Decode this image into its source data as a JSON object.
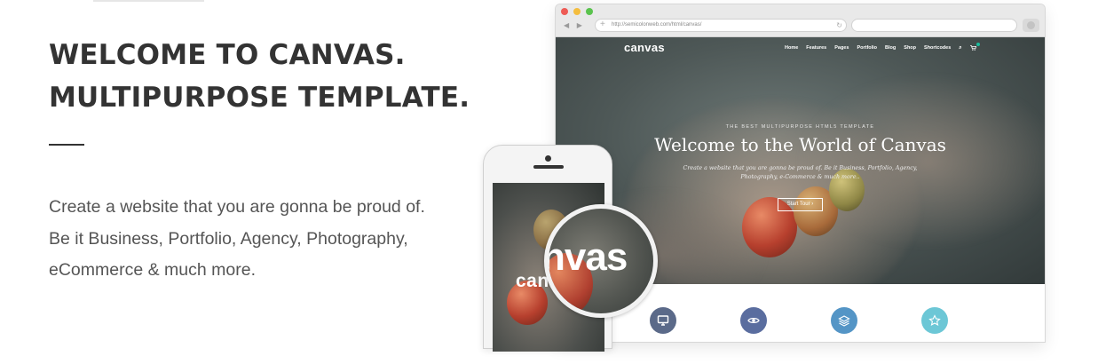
{
  "intro": {
    "heading_line1": "WELCOME TO CANVAS.",
    "heading_line2": "MULTIPURPOSE TEMPLATE.",
    "description": "Create a website that you are gonna be proud of. Be it Business, Portfolio, Agency, Photography, eCommerce & much more."
  },
  "browser": {
    "url": "http://semicolonweb.com/html/canvas/",
    "back_glyph": "◀ ▶",
    "plus_glyph": "+",
    "reload_glyph": "↻"
  },
  "site": {
    "logo": "canvas",
    "nav": [
      "Home",
      "Features",
      "Pages",
      "Portfolio",
      "Blog",
      "Shop",
      "Shortcodes"
    ],
    "search_icon": "⌕",
    "cart_icon": "🛒",
    "eyebrow": "THE BEST MULTIPURPOSE HTML5 TEMPLATE",
    "title": "Welcome to the World of Canvas",
    "subtitle": "Create a website that you are gonna be proud of. Be it Business, Portfolio, Agency, Photography, e-Commerce & much more..",
    "cta": "Start Tour ›"
  },
  "features": [
    {
      "icon": "monitor-icon",
      "color": "#5b6a89"
    },
    {
      "icon": "eye-icon",
      "color": "#5a6d9f"
    },
    {
      "icon": "layers-icon",
      "color": "#5495c6"
    },
    {
      "icon": "star-icon",
      "color": "#6cc7d6"
    }
  ],
  "phone": {
    "logo": "canv"
  },
  "lens": {
    "text": "nvas"
  }
}
